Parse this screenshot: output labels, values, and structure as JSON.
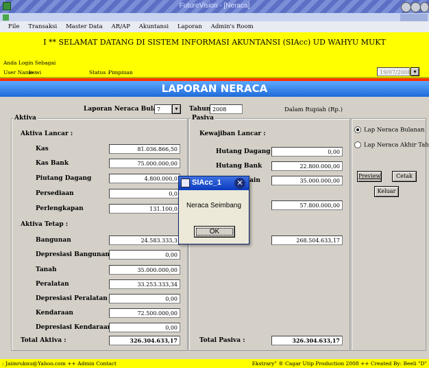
{
  "window": {
    "title": "FutureVision - [Neraca]"
  },
  "menu": [
    "File",
    "Transaksi",
    "Master Data",
    "AR/AP",
    "Akuntansi",
    "Laporan",
    "Admin's Room"
  ],
  "header": {
    "welcome": "I ** SELAMAT DATANG DI SISTEM INFORMASI AKUNTANSI (SIAcc) UD WAHYU MUKT",
    "login_label": "Anda Login Sebagai",
    "user_label": "User Name :",
    "user_value": "Iwwi",
    "status_label": "Status :",
    "status_value": "Pimpinan",
    "date": "19/07/2008"
  },
  "banner": "LAPORAN NERACA",
  "filter": {
    "bulan_label": "Laporan Neraca Bulan:",
    "bulan_value": "7",
    "tahun_label": "Tahun:",
    "tahun_value": "2008",
    "unit": "Dalam Rupiah (Rp.)"
  },
  "aktiva": {
    "title": "Aktiva",
    "lancar_title": "Aktiva Lancar :",
    "kas_label": "Kas",
    "kas": "81.036.866,50",
    "kasbank_label": "Kas Bank",
    "kasbank": "75.000.000,00",
    "piutang_label": "Piutang Dagang",
    "piutang": "4.800.000,0",
    "persediaan_label": "Persediaan",
    "persediaan": "0,0",
    "perlengkapan_label": "Perlengkapan",
    "perlengkapan": "131.100,0",
    "tetap_title": "Aktiva Tetap :",
    "bangunan_label": "Bangunan",
    "bangunan": "24.583.333,3",
    "dep_bangunan_label": "Depresiasi Bangunan",
    "dep_bangunan": "0,00",
    "tanah_label": "Tanah",
    "tanah": "35.000.000,00",
    "peralatan_label": "Peralatan",
    "peralatan": "33.253.333,34",
    "dep_peralatan_label": "Depresiasi Peralatan",
    "dep_peralatan": "0,00",
    "kendaraan_label": "Kendaraan",
    "kendaraan": "72.500.000,00",
    "dep_kendaraan_label": "Depresiasi Kendaraan",
    "dep_kendaraan": "0,00",
    "total_label": "Total Aktiva :",
    "total": "326.304.633,17"
  },
  "pasiva": {
    "title": "Pasiva",
    "lancar_title": "Kewajiban Lancar :",
    "hutang_dagang_label": "Hutang Dagang",
    "hutang_dagang": "0,00",
    "hutang_bank_label": "Hutang Bank",
    "hutang_bank": "22.800.000,00",
    "hutang_lain_label": "-Lain",
    "hutang_lain": "35.000.000,00",
    "subtotal": "57.800.000,00",
    "modal": "268.504.633,17",
    "total_label": "Total Pasiva :",
    "total": "326.304.633,17"
  },
  "options": {
    "bulanan": "Lap Neraca Bulanan",
    "akhir_tahun": "Lap Neraca Akhir Tahun",
    "preview": "Preview",
    "cetak": "Cetak",
    "keluar": "Keluar"
  },
  "dialog": {
    "title": "SIAcc_1",
    "message": "Neraca Seimbang",
    "ok": "OK"
  },
  "status": {
    "left": ": Jaimruknu@Yahoo.com ++ Admin Contact",
    "right": "Ekstrary\" ® Cagar Utip Production 2008 ++ Created By: Beeli \"D\""
  },
  "colors": {
    "banner": "#1f6bd8",
    "header": "#ffff00",
    "accent": "#ff3300"
  }
}
